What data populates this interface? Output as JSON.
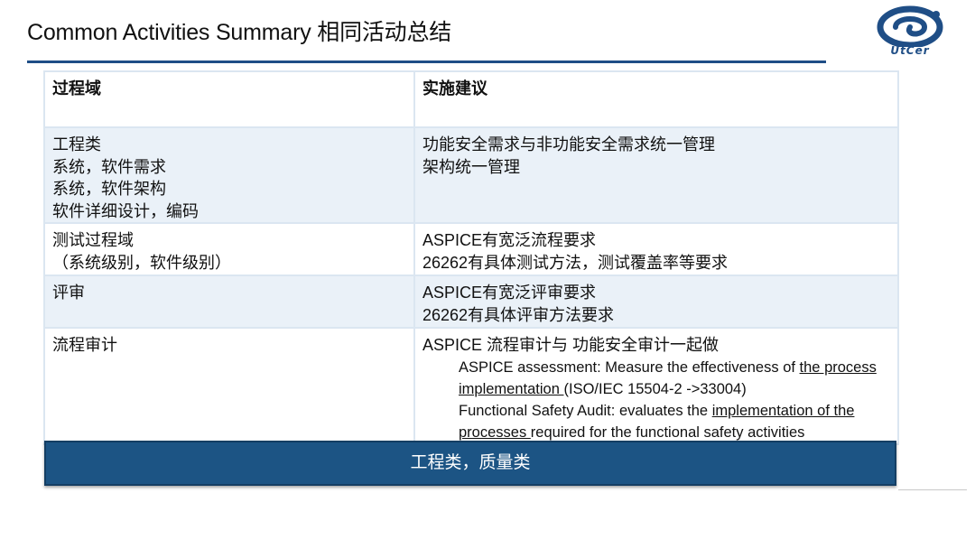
{
  "slide": {
    "title": "Common Activities Summary 相同活动总结",
    "logo_text": "UtCer",
    "banner": "工程类，质量类"
  },
  "table": {
    "headers": [
      "过程域",
      "实施建议"
    ],
    "rows": [
      {
        "left": [
          "工程类",
          "系统，软件需求",
          "系统，软件架构",
          "软件详细设计，编码"
        ],
        "right": [
          "功能安全需求与非功能安全需求统一管理",
          "架构统一管理"
        ]
      },
      {
        "left": [
          "测试过程域",
          "（系统级别，软件级别）"
        ],
        "right": [
          "ASPICE有宽泛流程要求",
          "26262有具体测试方法，测试覆盖率等要求"
        ]
      },
      {
        "left": [
          "评审"
        ],
        "right": [
          "ASPICE有宽泛评审要求",
          "26262有具体评审方法要求"
        ]
      },
      {
        "left": [
          "流程审计"
        ],
        "right_main": "ASPICE 流程审计与 功能安全审计一起做",
        "assessment": {
          "prefix": "ASPICE assessment: Measure the effectiveness of ",
          "link": "the process implementation ",
          "suffix": "(ISO/IEC 15504-2 ->33004)"
        },
        "audit": {
          "prefix": "Functional Safety Audit: evaluates the ",
          "link": "implementation of the processes ",
          "suffix": "required for the functional safety activities"
        }
      }
    ]
  },
  "colors": {
    "accent": "#1f4e86",
    "banner_bg": "#1c5484",
    "row_shade": "#eaf1f8",
    "border": "#dbe6f1"
  },
  "icons": {
    "logo": "utcer-logo-icon"
  }
}
